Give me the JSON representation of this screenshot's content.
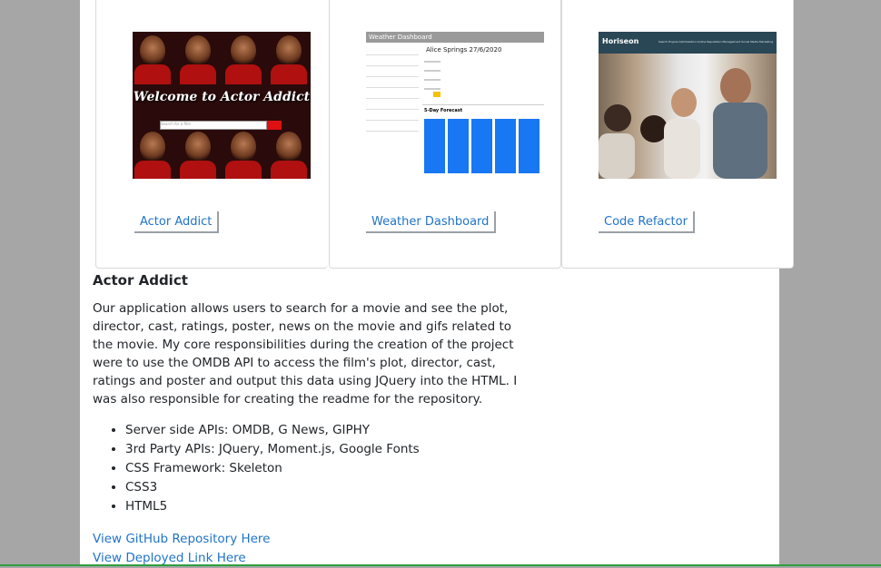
{
  "projects": [
    {
      "button": "Actor Addict",
      "thumb": {
        "title": "Welcome to Actor Addict",
        "search_placeholder": "Search for a film"
      }
    },
    {
      "button": "Weather Dashboard",
      "thumb": {
        "header": "Weather Dashboard",
        "city": "Alice Springs 27/6/2020",
        "forecast": "5-Day Forecast"
      }
    },
    {
      "button": "Code Refactor",
      "thumb": {
        "logo": "Horiseon",
        "nav": "Search Engine Optimization   Online Reputation Management   Social Media Marketing"
      }
    }
  ],
  "detail": {
    "title": "Actor Addict",
    "description": "Our application allows users to search for a movie and see the plot, director, cast, ratings, poster, news on the movie and gifs related to the movie. My core responsibilities during the creation of the project were to use the OMDB API to access the film's plot, director, cast, ratings and poster and output this data using JQuery into the HTML. I was also responsible for creating the readme for the repository.",
    "tech": [
      "Server side APIs: OMDB, G News, GIPHY",
      "3rd Party APIs: JQuery, Moment.js, Google Fonts",
      "CSS Framework: Skeleton",
      "CSS3",
      "HTML5"
    ],
    "links": {
      "github": "View GitHub Repository Here",
      "deployed": "View Deployed Link Here"
    }
  }
}
